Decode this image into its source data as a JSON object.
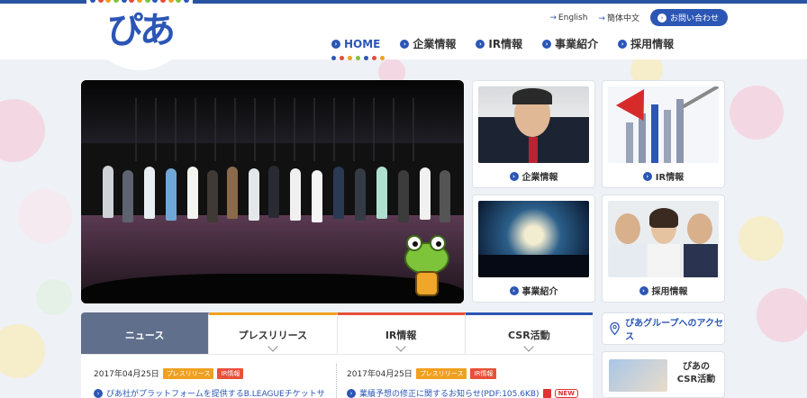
{
  "header": {
    "logo_text": "ぴあ",
    "utility_links": [
      "English",
      "簡体中文"
    ],
    "contact_label": "お問い合わせ"
  },
  "nav": {
    "items": [
      "HOME",
      "企業情報",
      "IR情報",
      "事業紹介",
      "採用情報"
    ],
    "active": "HOME"
  },
  "tiles": [
    {
      "label": "企業情報"
    },
    {
      "label": "IR情報"
    },
    {
      "label": "事業紹介"
    },
    {
      "label": "採用情報"
    }
  ],
  "news": {
    "tabs": [
      "ニュース",
      "プレスリリース",
      "IR情報",
      "CSR活動"
    ],
    "active_tab": "ニュース",
    "items": [
      {
        "date": "2017年04月25日",
        "badges": [
          "プレスリリース",
          "IR情報"
        ],
        "title": "ぴあ社がプラットフォームを提供するB.LEAGUEチケットサ"
      },
      {
        "date": "2017年04月25日",
        "badges": [
          "プレスリリース",
          "IR情報"
        ],
        "title": "業績予想の修正に関するお知らせ(PDF:105.6KB)",
        "new_label": "NEW"
      }
    ]
  },
  "sidebar": {
    "access_label": "ぴあグループへのアクセス",
    "csr_label_1": "ぴあの",
    "csr_label_2": "CSR活動"
  },
  "colors": {
    "brand_blue": "#2b56b5",
    "press_badge": "#f0a020",
    "ir_badge": "#e8503a",
    "tab_active": "#5f6f8c"
  }
}
